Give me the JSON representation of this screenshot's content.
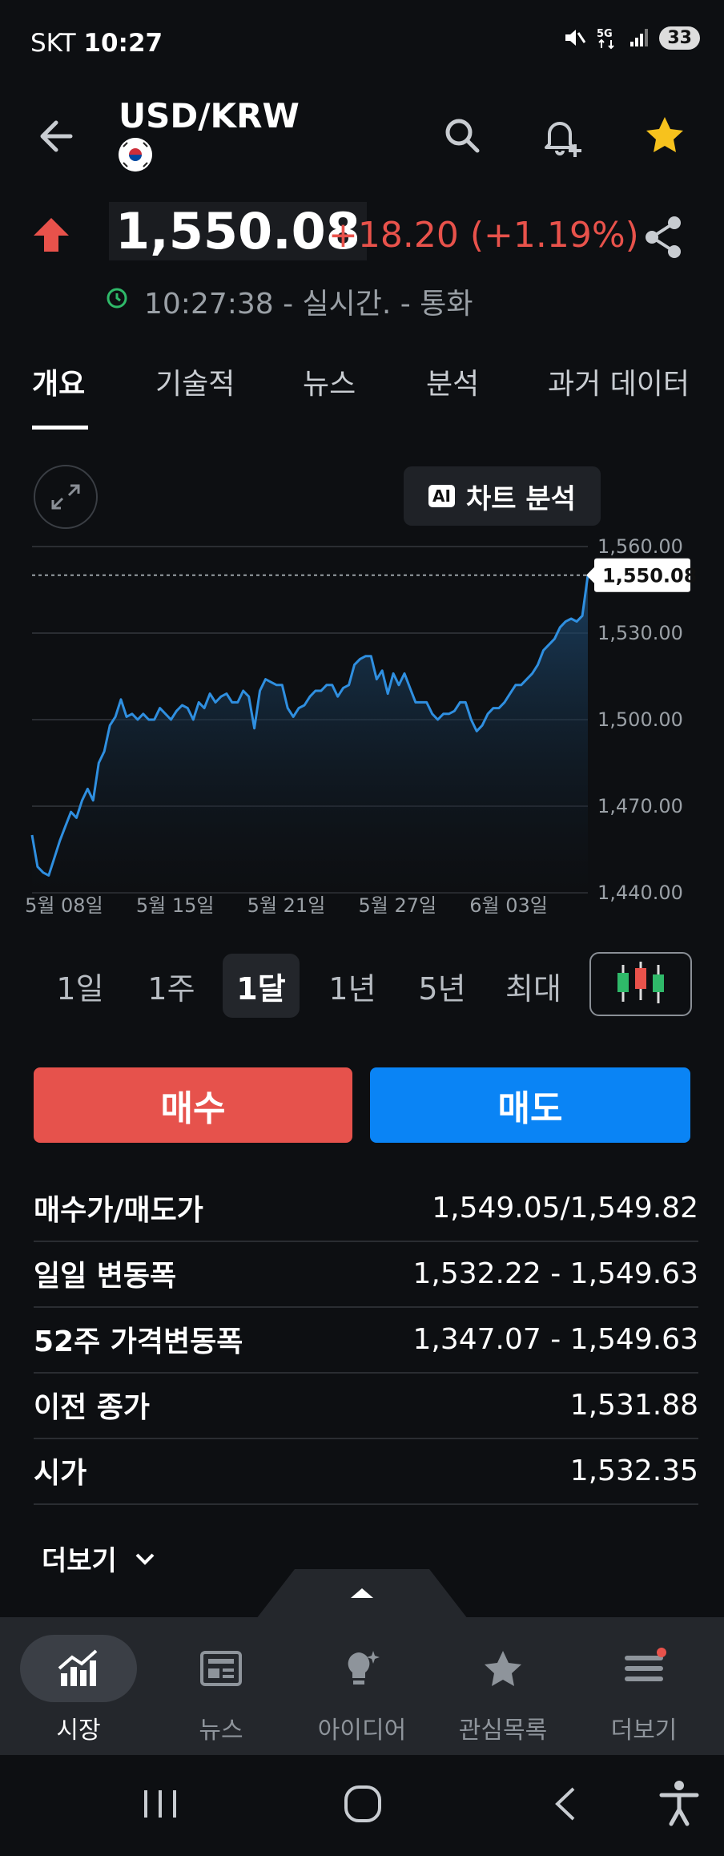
{
  "status_bar": {
    "carrier": "SKT",
    "time": "10:27",
    "battery": "33"
  },
  "header": {
    "title": "USD/KRW"
  },
  "quote": {
    "price": "1,550.08",
    "change": "+18.20 (+1.19%)",
    "timestamp": "10:27:38 - 실시간. - 통화"
  },
  "tabs": [
    "개요",
    "기술적",
    "뉴스",
    "분석",
    "과거 데이터"
  ],
  "ai_button": {
    "badge": "AI",
    "label": "차트 분석"
  },
  "chart_data": {
    "type": "area",
    "x_labels": [
      "5월 08일",
      "5월 15일",
      "5월 21일",
      "5월 27일",
      "6월 03일"
    ],
    "y_ticks": [
      "1,560.00",
      "1,530.00",
      "1,500.00",
      "1,470.00",
      "1,440.00"
    ],
    "ylim": [
      1440,
      1560
    ],
    "last_value_label": "1,550.08",
    "last_value": 1550.08,
    "series": [
      {
        "values": [
          1460,
          1449,
          1447,
          1446,
          1452,
          1458,
          1463,
          1468,
          1466,
          1472,
          1476,
          1472,
          1485,
          1489,
          1498,
          1501,
          1507,
          1501,
          1502,
          1500,
          1502,
          1500,
          1500,
          1504,
          1502,
          1500,
          1503,
          1505,
          1504,
          1500,
          1506,
          1504,
          1509,
          1506,
          1508,
          1509,
          1506,
          1506,
          1510,
          1508,
          1497,
          1510,
          1514,
          1513,
          1512,
          1512,
          1504,
          1501,
          1504,
          1505,
          1508,
          1510,
          1510,
          1512,
          1512,
          1508,
          1511,
          1512,
          1519,
          1521,
          1522,
          1522,
          1514,
          1517,
          1509,
          1516,
          1512,
          1516,
          1511,
          1506,
          1506,
          1506,
          1502,
          1500,
          1502,
          1502,
          1503,
          1506,
          1506,
          1500,
          1496,
          1498,
          1502,
          1504,
          1504,
          1506,
          1509,
          1512,
          1512,
          1514,
          1516,
          1519,
          1524,
          1526,
          1528,
          1532,
          1534,
          1535,
          1534,
          1536,
          1550
        ]
      }
    ]
  },
  "ranges": [
    "1일",
    "1주",
    "1달",
    "1년",
    "5년",
    "최대"
  ],
  "active_range": "1달",
  "buttons": {
    "buy": "매수",
    "sell": "매도"
  },
  "stats": [
    {
      "label": "매수가/매도가",
      "value": "1,549.05/1,549.82"
    },
    {
      "label": "일일 변동폭",
      "value": "1,532.22 - 1,549.63"
    },
    {
      "label": "52주 가격변동폭",
      "value": "1,347.07 - 1,549.63"
    },
    {
      "label": "이전 종가",
      "value": "1,531.88"
    },
    {
      "label": "시가",
      "value": "1,532.35"
    }
  ],
  "more": "더보기",
  "nav": [
    {
      "label": "시장",
      "icon": "chart-icon"
    },
    {
      "label": "뉴스",
      "icon": "news-icon"
    },
    {
      "label": "아이디어",
      "icon": "lightbulb-icon"
    },
    {
      "label": "관심목록",
      "icon": "star-icon"
    },
    {
      "label": "더보기",
      "icon": "menu-icon"
    }
  ],
  "colors": {
    "up": "#e8524b",
    "buy": "#e6524c",
    "sell": "#0a84f5",
    "line": "#2f8fe0",
    "star": "#f7c21d"
  }
}
